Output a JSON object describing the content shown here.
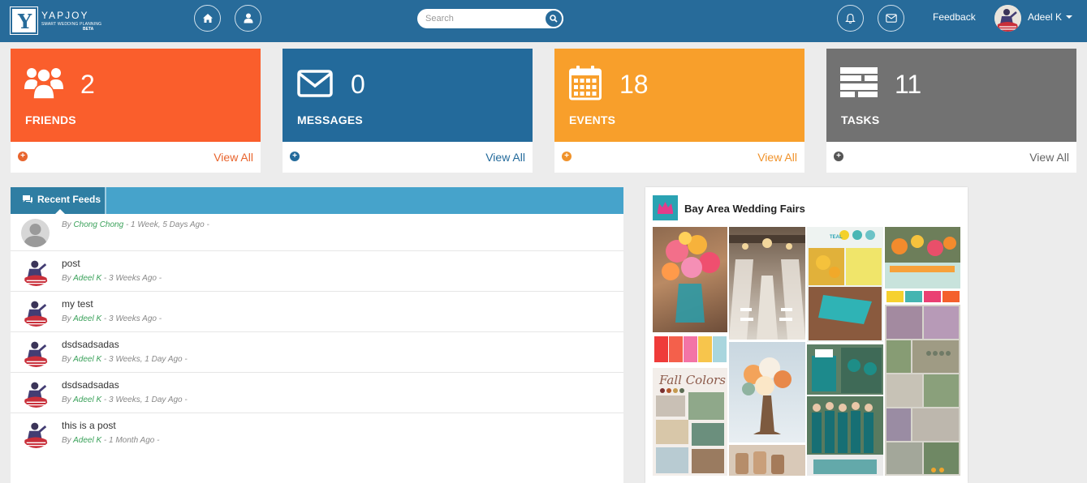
{
  "brand": {
    "name": "YAPJOY",
    "tagline": "SMART WEDDING PLANNING",
    "badge": "BETA",
    "logo_letter": "Y"
  },
  "nav": {
    "home_icon": "home-icon",
    "profile_icon": "user-icon",
    "search_placeholder": "Search",
    "search_value": "",
    "notifications_icon": "bell-icon",
    "messages_icon": "envelope-icon",
    "feedback_label": "Feedback",
    "user_name": "Adeel K"
  },
  "stats": [
    {
      "count": "2",
      "label": "FRIENDS",
      "link": "View All",
      "color": "#fa5e2c",
      "link_color": "#e8642d",
      "icon": "users-icon"
    },
    {
      "count": "0",
      "label": "MESSAGES",
      "link": "View All",
      "color": "#236a9b",
      "link_color": "#236a9b",
      "icon": "envelope-icon"
    },
    {
      "count": "18",
      "label": "EVENTS",
      "link": "View All",
      "color": "#f89f2b",
      "link_color": "#f0922a",
      "icon": "calendar-icon"
    },
    {
      "count": "11",
      "label": "TASKS",
      "link": "View All",
      "color": "#727272",
      "link_color": "#666666",
      "icon": "tasks-icon"
    }
  ],
  "feeds": {
    "tab_label": "Recent Feeds",
    "items": [
      {
        "title": "",
        "by": "By",
        "author": "Chong Chong",
        "time": "- 1 Week, 5 Days Ago -"
      },
      {
        "title": "post",
        "by": "By",
        "author": "Adeel K",
        "time": "- 3 Weeks Ago -"
      },
      {
        "title": "my test",
        "by": "By",
        "author": "Adeel K",
        "time": "- 3 Weeks Ago -"
      },
      {
        "title": "dsdsadsadas",
        "by": "By",
        "author": "Adeel K",
        "time": "- 3 Weeks, 1 Day Ago -"
      },
      {
        "title": "dsdsadsadas",
        "by": "By",
        "author": "Adeel K",
        "time": "- 3 Weeks, 1 Day Ago -"
      },
      {
        "title": "this is a post",
        "by": "By",
        "author": "Adeel K",
        "time": "- 1 Month Ago -"
      }
    ]
  },
  "board": {
    "title": "Bay Area Wedding Fairs",
    "collage_text": "Fall Colors",
    "teal_label": "TEAL"
  },
  "colors": {
    "topbar": "#276b9a",
    "feed_author": "#3aa15a"
  }
}
